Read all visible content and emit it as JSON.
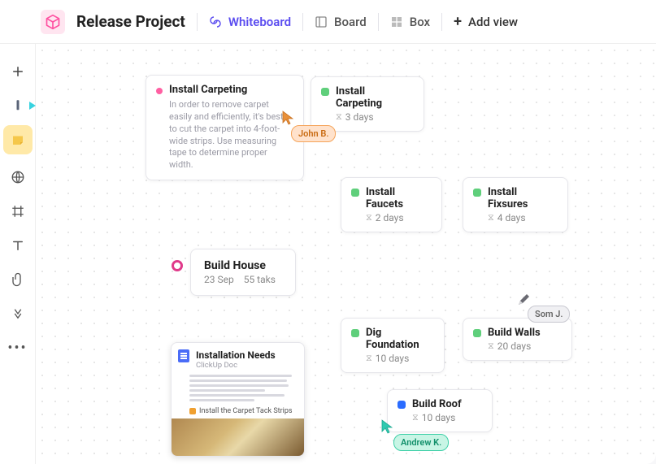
{
  "header": {
    "title": "Release Project",
    "tabs": {
      "whiteboard": "Whiteboard",
      "board": "Board",
      "box": "Box"
    },
    "add_view": "Add view"
  },
  "cards": {
    "carpeting_detail": {
      "title": "Install Carpeting",
      "desc": "In order to remove carpet easily and efficiently, it's best to cut the carpet into 4-foot-wide strips. Use measuring tape to determine proper width."
    },
    "carpeting_task": {
      "title": "Install Carpeting",
      "duration": "3 days"
    },
    "faucets": {
      "title": "Install Faucets",
      "duration": "2 days"
    },
    "fixtures": {
      "title": "Install Fixsures",
      "duration": "4 days"
    },
    "house": {
      "title": "Build House",
      "date": "23 Sep",
      "tasks": "55 taks"
    },
    "foundation": {
      "title": "Dig Foundation",
      "duration": "10 days"
    },
    "walls": {
      "title": "Build Walls",
      "duration": "20 days"
    },
    "roof": {
      "title": "Build Roof",
      "duration": "10 days"
    },
    "doc": {
      "title": "Installation Needs",
      "sub": "ClickUp Doc",
      "snippet": "Install the Carpet Tack Strips"
    }
  },
  "people": {
    "john": "John B.",
    "som": "Som J.",
    "andrew": "Andrew K."
  }
}
